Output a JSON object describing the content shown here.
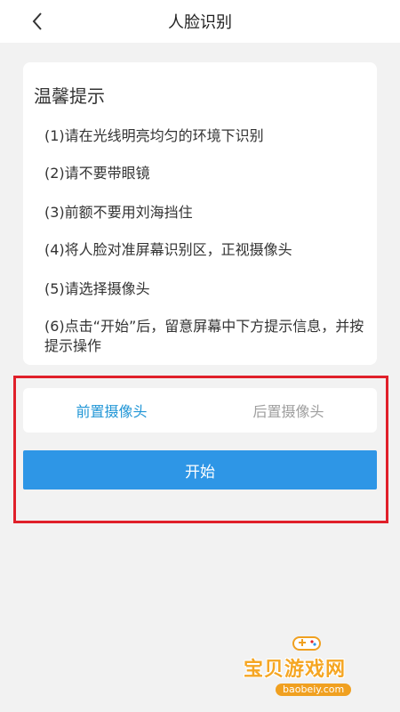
{
  "header": {
    "title": "人脸识别",
    "back_icon": "chevron-left-icon"
  },
  "tips": {
    "title": "温馨提示",
    "items": [
      "(1)请在光线明亮均匀的环境下识别",
      "(2)请不要带眼镜",
      "(3)前额不要用刘海挡住",
      "(4)将人脸对准屏幕识别区，正视摄像头",
      "(5)请选择摄像头",
      "(6)点击“开始”后，留意屏幕中下方提示信息，并按提示操作"
    ]
  },
  "camera": {
    "front_label": "前置摄像头",
    "rear_label": "后置摄像头",
    "selected": "front"
  },
  "start_button": {
    "label": "开始"
  },
  "watermark": {
    "name": "宝贝游戏网",
    "url": "baobeiy.com",
    "icon": "gamepad-icon"
  },
  "colors": {
    "accent": "#2196d6",
    "button": "#2e96e6",
    "highlight_frame": "#e0202a",
    "background": "#f2f2f2"
  }
}
